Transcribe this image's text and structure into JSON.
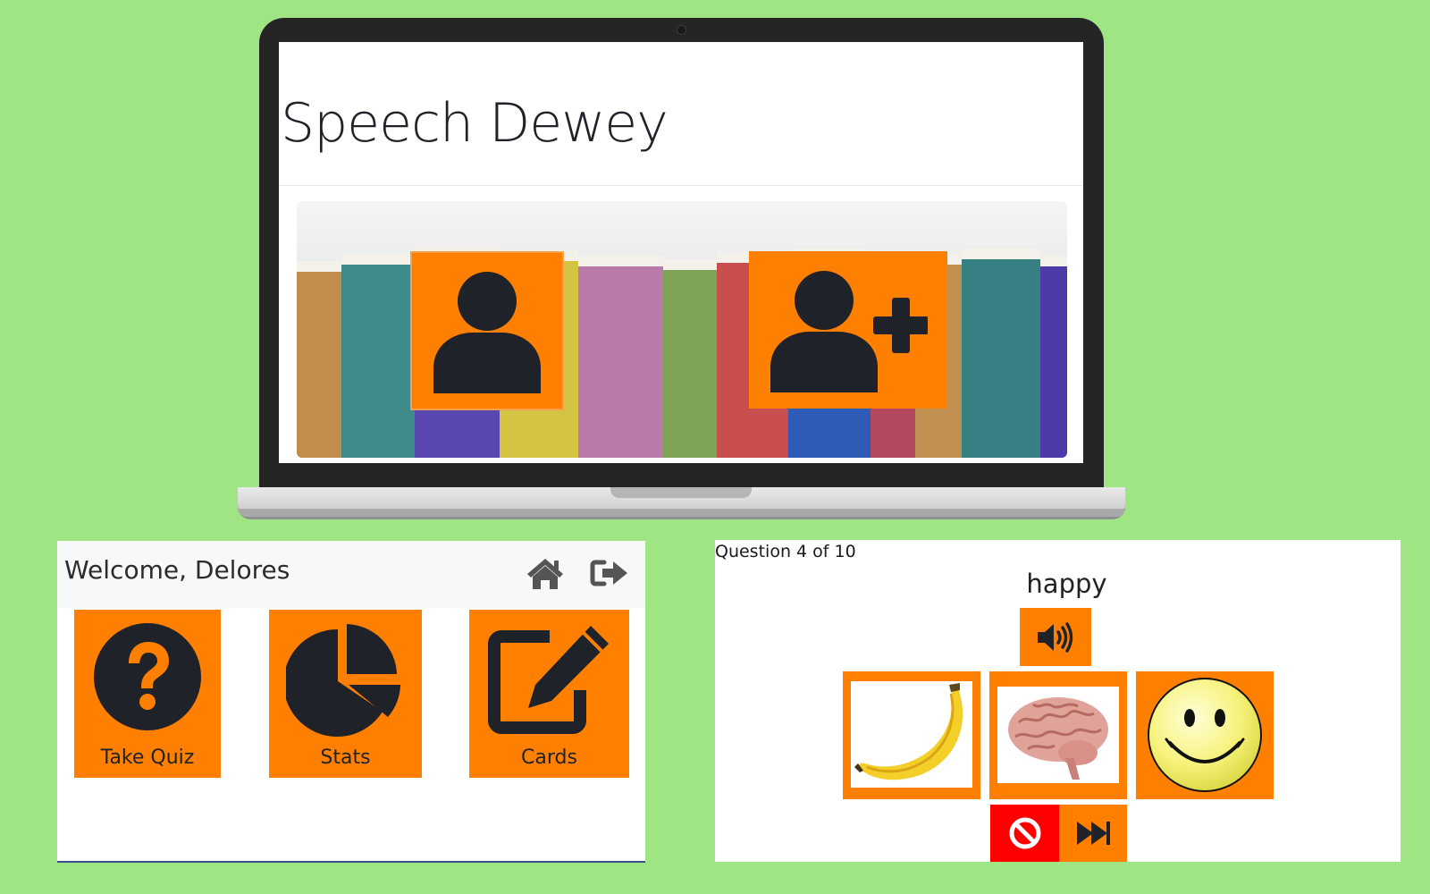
{
  "landing": {
    "title": "Speech Dewey",
    "login_icon": "user-icon",
    "signup_icon": "user-plus-icon"
  },
  "dashboard": {
    "welcome": "Welcome, Delores",
    "home_icon": "home-icon",
    "logout_icon": "sign-out-icon",
    "tiles": [
      {
        "label": "Take Quiz",
        "icon": "question-circle-icon"
      },
      {
        "label": "Stats",
        "icon": "pie-chart-icon"
      },
      {
        "label": "Cards",
        "icon": "edit-icon"
      }
    ]
  },
  "quiz": {
    "counter": "Question 4 of 10",
    "word": "happy",
    "audio_icon": "volume-up-icon",
    "answers": [
      {
        "name": "banana"
      },
      {
        "name": "brain"
      },
      {
        "name": "smiley-face"
      }
    ],
    "skip_icon": "ban-icon",
    "next_icon": "fast-forward-icon"
  },
  "colors": {
    "background": "#a0e583",
    "accent": "#ff8000",
    "danger": "#ff0000",
    "icon": "#1f2228"
  }
}
